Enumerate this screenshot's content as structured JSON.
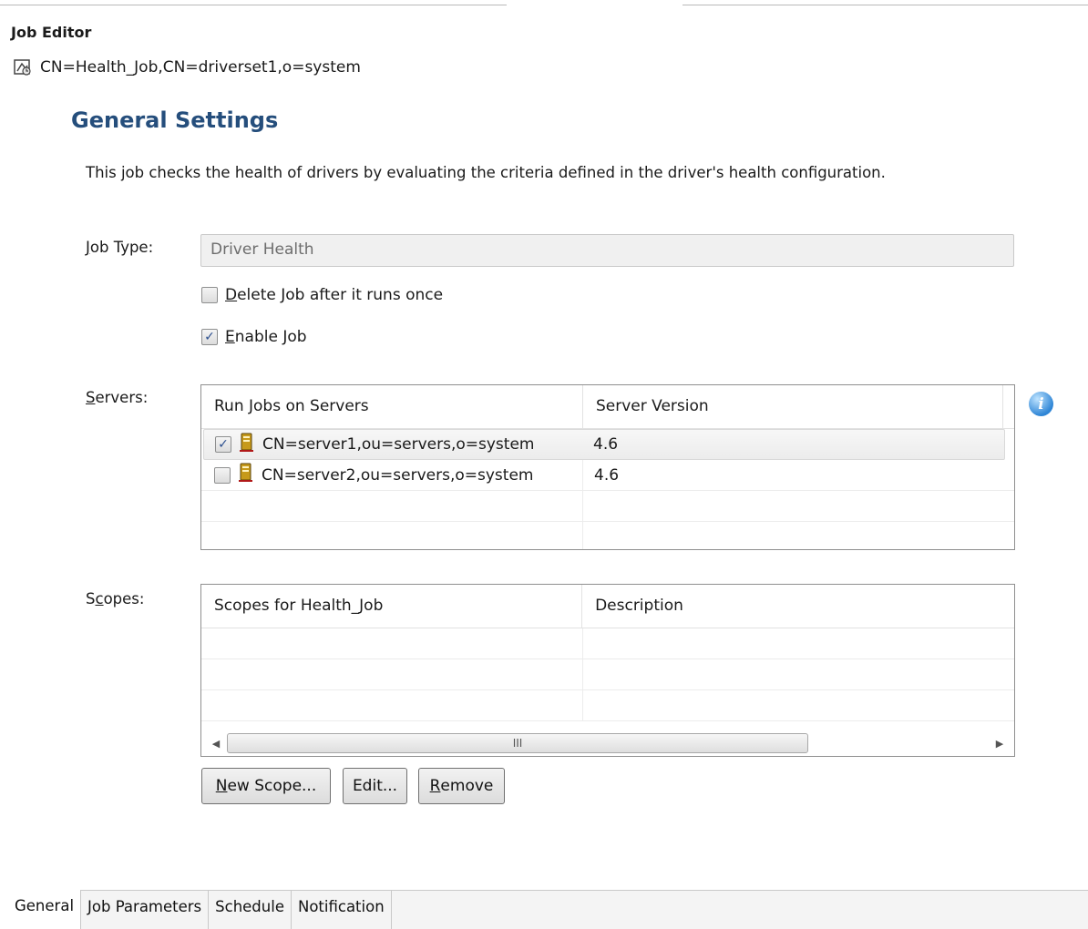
{
  "editor": {
    "title": "Job Editor",
    "dn": "CN=Health_Job,CN=driverset1,o=system"
  },
  "general": {
    "section_title": "General Settings",
    "description": "This job checks the health of drivers by evaluating the criteria defined in the driver's health configuration.",
    "job_type": {
      "label_mnemonic": "J",
      "label_rest": "ob Type:",
      "value": "Driver Health"
    },
    "delete_job": {
      "mnemonic": "D",
      "rest": "elete Job after it runs once",
      "checked": false
    },
    "enable_job": {
      "mnemonic": "E",
      "rest": "nable Job",
      "checked": true
    }
  },
  "servers": {
    "label_mnemonic": "S",
    "label_rest": "ervers:",
    "columns": [
      "Run Jobs on Servers",
      "Server Version"
    ],
    "rows": [
      {
        "checked": true,
        "name": "CN=server1,ou=servers,o=system",
        "version": "4.6"
      },
      {
        "checked": false,
        "name": "CN=server2,ou=servers,o=system",
        "version": "4.6"
      }
    ]
  },
  "scopes": {
    "label_first": "S",
    "label_mnemonic": "c",
    "label_rest": "opes:",
    "columns": [
      "Scopes for Health_Job",
      "Description"
    ],
    "scrollbar_grip": "III"
  },
  "buttons": {
    "new_scope": {
      "mnemonic": "N",
      "rest": "ew Scope..."
    },
    "edit": {
      "mnemonic": "",
      "rest": "Edit..."
    },
    "remove": {
      "mnemonic": "R",
      "rest": "emove"
    }
  },
  "tabs": [
    "General",
    "Job Parameters",
    "Schedule",
    "Notification"
  ],
  "colors": {
    "section_title": "#254e7c",
    "info_icon": "#2f86d6",
    "server_icon": "#c79a1a"
  }
}
